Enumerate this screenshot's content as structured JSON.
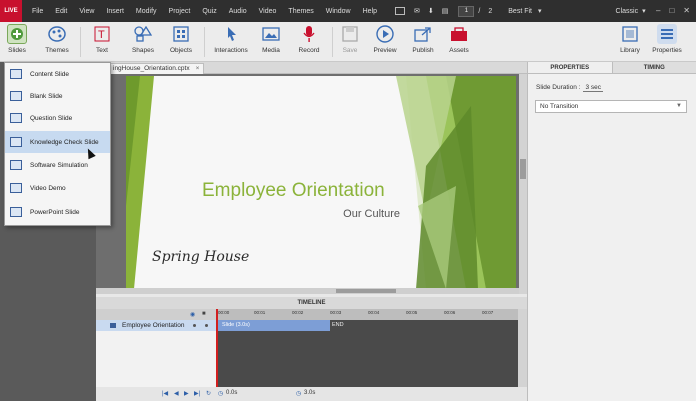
{
  "menubar": {
    "live_badge": "LIVE",
    "items": [
      "File",
      "Edit",
      "View",
      "Insert",
      "Modify",
      "Project",
      "Quiz",
      "Audio",
      "Video",
      "Themes",
      "Window",
      "Help"
    ],
    "current_page": "1",
    "page_separator": "/",
    "total_pages": "2",
    "zoom": "Best Fit",
    "workspace": "Classic"
  },
  "toolbar": {
    "slides": "Slides",
    "themes": "Themes",
    "text": "Text",
    "shapes": "Shapes",
    "objects": "Objects",
    "interactions": "Interactions",
    "media": "Media",
    "record": "Record",
    "save": "Save",
    "preview": "Preview",
    "publish": "Publish",
    "assets": "Assets",
    "library": "Library",
    "properties": "Properties"
  },
  "slides_menu": {
    "items": [
      {
        "label": "Content Slide",
        "icon": "content-slide-icon"
      },
      {
        "label": "Blank Slide",
        "icon": "blank-slide-icon"
      },
      {
        "label": "Question Slide",
        "icon": "question-slide-icon"
      },
      {
        "label": "Knowledge Check Slide",
        "icon": "knowledge-check-icon"
      },
      {
        "label": "Software Simulation",
        "icon": "software-simulation-icon"
      },
      {
        "label": "Video Demo",
        "icon": "video-demo-icon"
      },
      {
        "label": "PowerPoint Slide",
        "icon": "powerpoint-slide-icon"
      }
    ],
    "highlighted_index": 3
  },
  "document": {
    "tab_label": "ingHouse_Orientation.cptx",
    "close": "×"
  },
  "slide": {
    "title": "Employee Orientation",
    "subtitle": "Our Culture",
    "logo_text": "Spring House",
    "accent_color": "#8bb33a"
  },
  "properties_panel": {
    "tab_properties": "PROPERTIES",
    "tab_timing": "TIMING",
    "duration_label": "Slide Duration :",
    "duration_value": "3 sec",
    "transition": "No Transition"
  },
  "timeline": {
    "title": "TIMELINE",
    "ticks": [
      "00:00",
      "00:01",
      "00:02",
      "00:03",
      "00:04",
      "00:05",
      "00:06",
      "00:07"
    ],
    "layer_name": "Employee Orientation",
    "bar_label": "Slide (3.0s)",
    "end_label": "END",
    "foot_start": "0.0s",
    "foot_duration": "3.0s"
  }
}
